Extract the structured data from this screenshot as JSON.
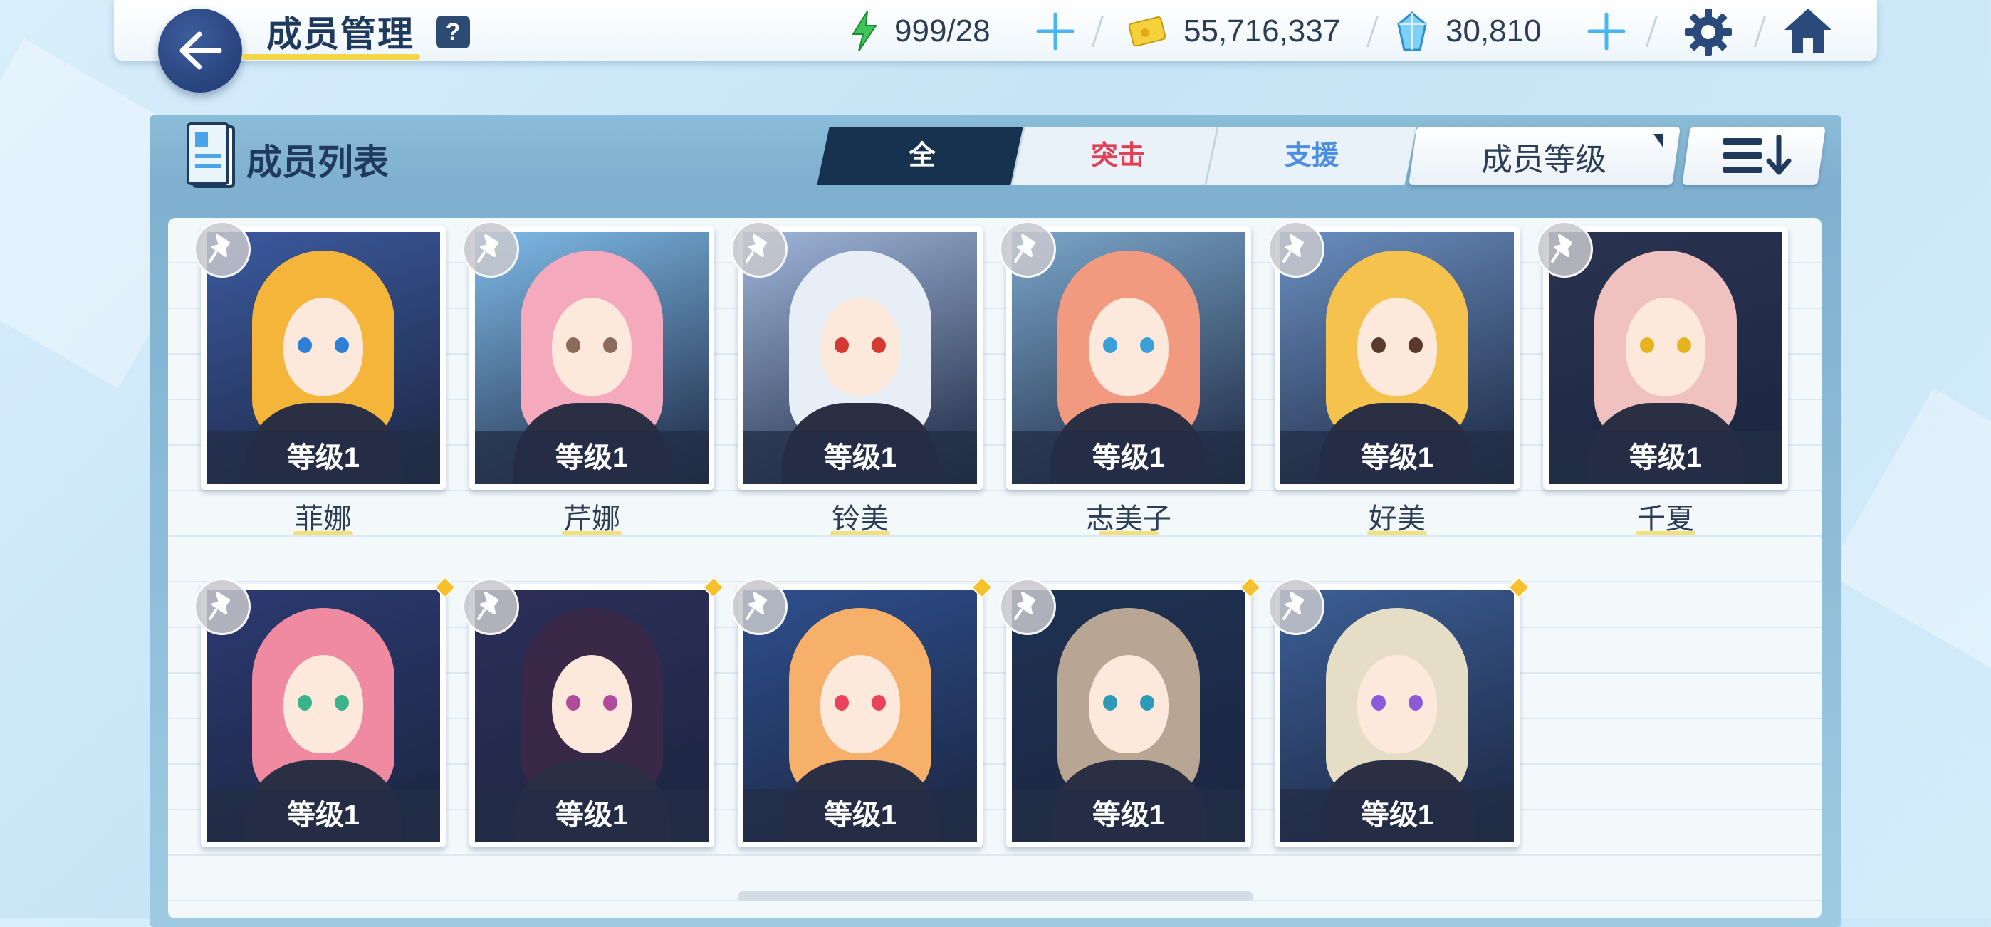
{
  "header": {
    "title": "成员管理",
    "help_label": "?",
    "ap": "999/28",
    "credits": "55,716,337",
    "pyroxene": "30,810"
  },
  "panel": {
    "title": "成员列表",
    "tabs": [
      {
        "label": "全",
        "active": true,
        "color": "#ffffff"
      },
      {
        "label": "突击",
        "active": false,
        "color": "#e14156"
      },
      {
        "label": "支援",
        "active": false,
        "color": "#4c8ee0"
      }
    ],
    "sort_label": "成员等级"
  },
  "students_row1": [
    {
      "level": "等级1",
      "name": "菲娜",
      "hair": "#f4b53a",
      "bg": "#3c5aa0",
      "eye": "#2f7fd6"
    },
    {
      "level": "等级1",
      "name": "芹娜",
      "hair": "#f4a9bd",
      "bg": "#7fbbe8",
      "eye": "#8b6a5a"
    },
    {
      "level": "等级1",
      "name": "铃美",
      "hair": "#e8eef5",
      "bg": "#9fb6da",
      "eye": "#d33b32"
    },
    {
      "level": "等级1",
      "name": "志美子",
      "hair": "#f29a80",
      "bg": "#7aa6c9",
      "eye": "#3b9fd8"
    },
    {
      "level": "等级1",
      "name": "好美",
      "hair": "#f5c24e",
      "bg": "#6a8fc0",
      "eye": "#5a3a2a"
    },
    {
      "level": "等级1",
      "name": "千夏",
      "hair": "#efc2c0",
      "bg": "#2a3350",
      "eye": "#e6b320"
    }
  ],
  "students_row2": [
    {
      "level": "等级1",
      "hair": "#f08aa0",
      "bg": "#2c3a72",
      "eye": "#3ab28a"
    },
    {
      "level": "等级1",
      "hair": "#3a2848",
      "bg": "#2d2f5a",
      "eye": "#b04a9c"
    },
    {
      "level": "等级1",
      "hair": "#f6b06a",
      "bg": "#2e4f8e",
      "eye": "#e8435a"
    },
    {
      "level": "等级1",
      "hair": "#b9a594",
      "bg": "#1f3253",
      "eye": "#2e9ab8"
    },
    {
      "level": "等级1",
      "hair": "#e6ddc6",
      "bg": "#3c5f96",
      "eye": "#8a5ad8"
    }
  ],
  "colors": {
    "accent": "#17324f",
    "title_underline": "#f3d64a",
    "new_dot": "#f6c12c"
  }
}
